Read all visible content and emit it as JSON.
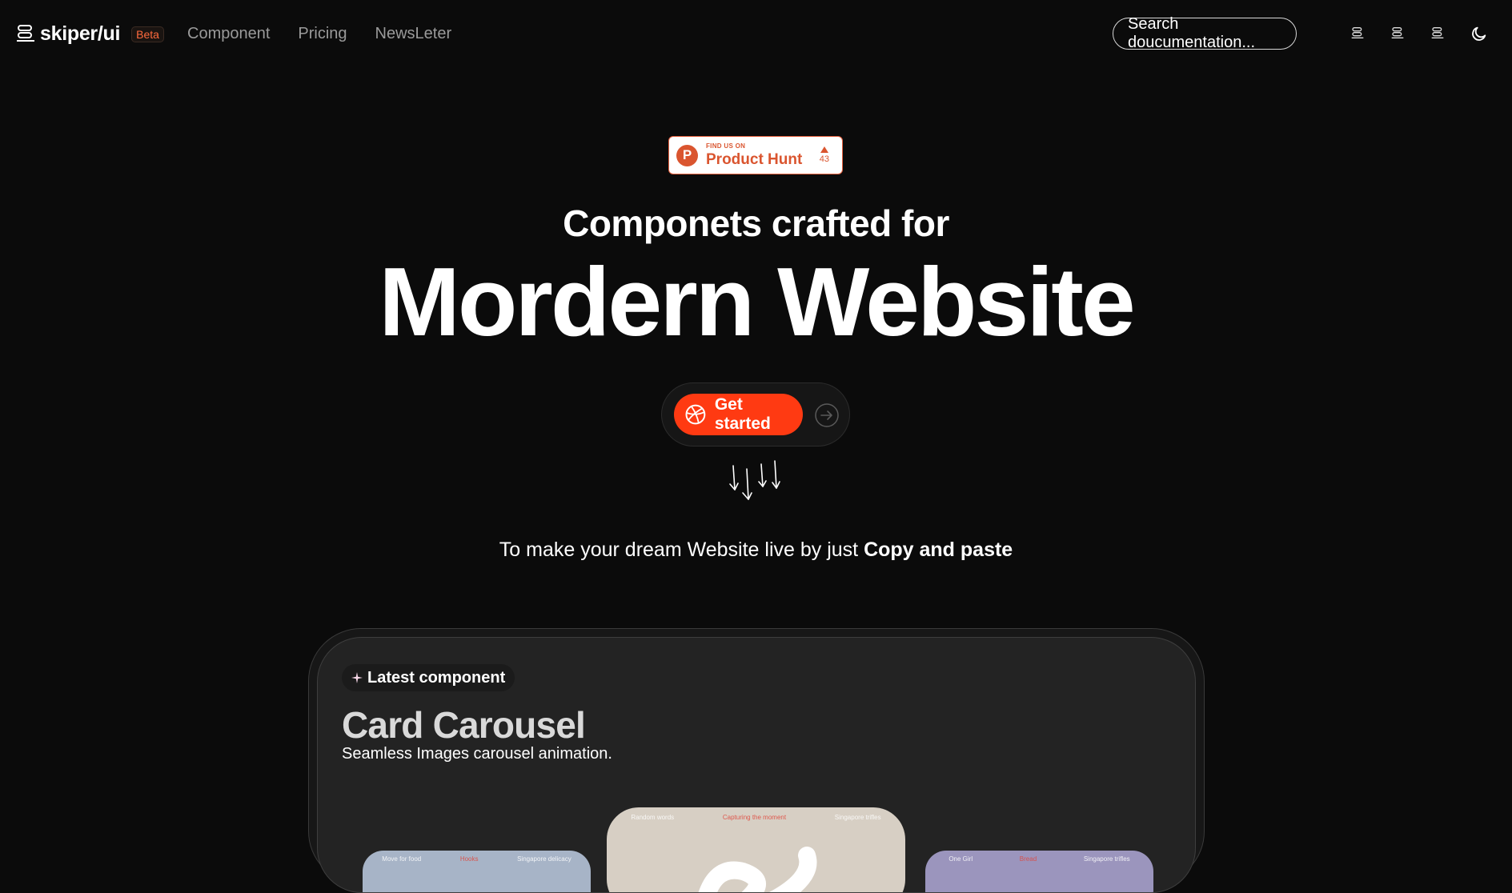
{
  "brand": {
    "name": "skiper/ui",
    "badge": "Beta"
  },
  "nav": {
    "links": [
      "Component",
      "Pricing",
      "NewsLeter"
    ],
    "search_placeholder": "Search doucumentation...",
    "icons": [
      "skiper-logo-icon",
      "skiper-logo-icon",
      "skiper-logo-icon",
      "moon-icon"
    ]
  },
  "product_hunt": {
    "small": "FIND US ON",
    "name": "Product Hunt",
    "votes": "43",
    "letter": "P"
  },
  "hero": {
    "subtitle": "Componets crafted for",
    "title": "Mordern Website",
    "cta_label": "Get started",
    "tagline_regular": "To make your dream Website live by just",
    "tagline_bold": "Copy and paste"
  },
  "latest": {
    "chip_label": "Latest component",
    "title": "Card Carousel",
    "description": "Seamless Images carousel animation.",
    "slides": [
      {
        "captions": [
          "Move for food",
          "Hooks",
          "Singapore delicacy"
        ],
        "highlight": 1
      },
      {
        "captions": [
          "Random words",
          "Capturing the moment",
          "Singapore trifles"
        ],
        "highlight": 1
      },
      {
        "captions": [
          "One Girl",
          "Bread",
          "Singapore trifles"
        ],
        "highlight": 1
      }
    ]
  },
  "colors": {
    "accent": "#ff3a12",
    "brand_badge": "#ff6a3d",
    "product_hunt": "#da552f",
    "background": "#0b0b0b"
  }
}
